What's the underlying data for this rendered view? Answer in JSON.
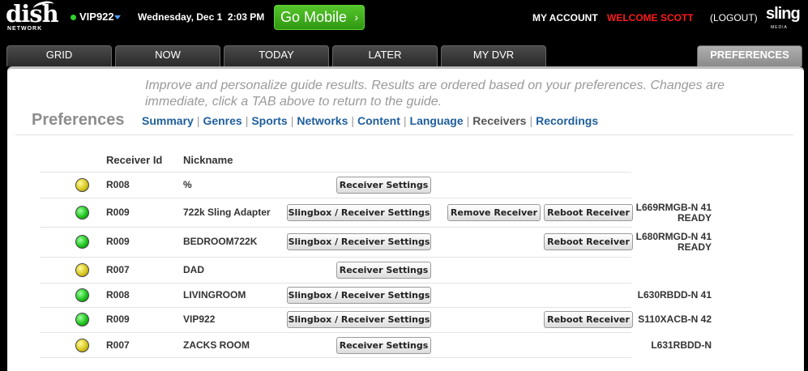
{
  "header": {
    "logo_text": "dish",
    "logo_sub": "NETWORK",
    "receiver": "VIP922",
    "datetime": "Wednesday, Dec 1  2:03 PM",
    "go_mobile": "Go Mobile",
    "my_account": "MY ACCOUNT",
    "welcome": "WELCOME SCOTT",
    "logout": "(LOGOUT)",
    "sling": "sling",
    "sling_sub": "MEDIA"
  },
  "tabs": [
    {
      "label": "GRID"
    },
    {
      "label": "NOW"
    },
    {
      "label": "TODAY"
    },
    {
      "label": "LATER"
    },
    {
      "label": "MY DVR"
    },
    {
      "label": "PREFERENCES",
      "active": true
    }
  ],
  "intro": "Improve and personalize guide results. Results are ordered based on your preferences. Changes are immediate, click a TAB above to return to the guide.",
  "preferences_title": "Preferences",
  "subnav": {
    "summary": "Summary",
    "genres": "Genres",
    "sports": "Sports",
    "networks": "Networks",
    "content": "Content",
    "language": "Language",
    "receivers": "Receivers",
    "recordings": "Recordings"
  },
  "table": {
    "col_receiver_id": "Receiver Id",
    "col_nickname": "Nickname",
    "rows": [
      {
        "led": "yellow",
        "id": "R008",
        "nickname": "%",
        "settings": "Receiver Settings",
        "remove": "",
        "reboot": "",
        "status1": "",
        "status2": ""
      },
      {
        "led": "green",
        "id": "R009",
        "nickname": "722k Sling Adapter",
        "settings": "Slingbox / Receiver Settings",
        "remove": "Remove Receiver",
        "reboot": "Reboot Receiver",
        "status1": "L669RMGB-N 41",
        "status2": "READY"
      },
      {
        "led": "green",
        "id": "R009",
        "nickname": "BEDROOM722K",
        "settings": "Slingbox / Receiver Settings",
        "remove": "",
        "reboot": "Reboot Receiver",
        "status1": "L680RMGD-N 41",
        "status2": "READY"
      },
      {
        "led": "yellow",
        "id": "R007",
        "nickname": "DAD",
        "settings": "Receiver Settings",
        "remove": "",
        "reboot": "",
        "status1": "",
        "status2": ""
      },
      {
        "led": "green",
        "id": "R008",
        "nickname": "LIVINGROOM",
        "settings": "Slingbox / Receiver Settings",
        "remove": "",
        "reboot": "",
        "status1": "L630RBDD-N 41",
        "status2": ""
      },
      {
        "led": "green",
        "id": "R009",
        "nickname": "VIP922",
        "settings": "Slingbox / Receiver Settings",
        "remove": "",
        "reboot": "Reboot Receiver",
        "status1": "S110XACB-N 42",
        "status2": ""
      },
      {
        "led": "yellow",
        "id": "R007",
        "nickname": "ZACKS ROOM",
        "settings": "Receiver Settings",
        "remove": "",
        "reboot": "",
        "status1": "L631RBDD-N",
        "status2": ""
      }
    ]
  }
}
